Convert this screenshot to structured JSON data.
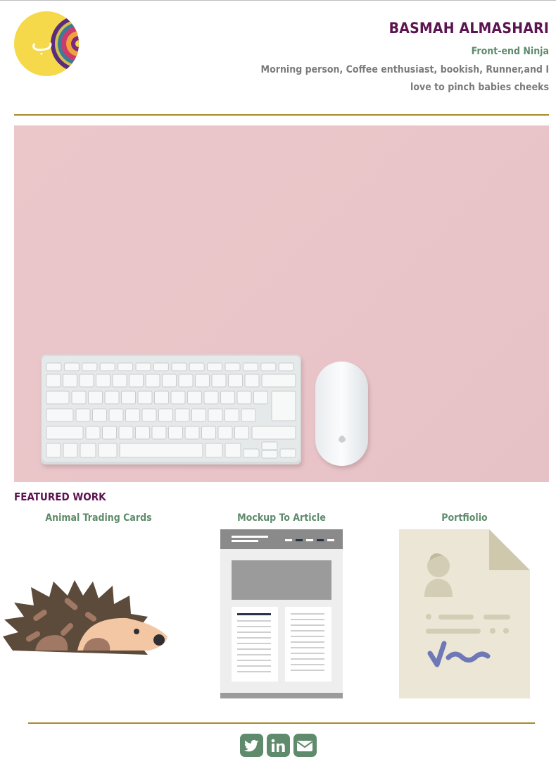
{
  "header": {
    "name": "BASMAH ALMASHARI",
    "role": "Front-end Ninja",
    "bio": "Morning person, Coffee enthusiast, bookish, Runner,and I love to pinch babies cheeks",
    "logo_letter": "ب"
  },
  "hero": {
    "image": "keyboard-and-mouse-on-pink-desk",
    "background_color": "#e9c5c9"
  },
  "featured": {
    "title": "FEATURED WORK",
    "items": [
      {
        "title": "Animal Trading Cards",
        "image": "hedgehog-illustration"
      },
      {
        "title": "Mockup To Article",
        "image": "article-mockup-illustration"
      },
      {
        "title": "Portfiolio",
        "image": "resume-document-illustration"
      }
    ]
  },
  "social": [
    {
      "name": "twitter",
      "icon": "twitter-icon"
    },
    {
      "name": "linkedin",
      "icon": "linkedin-icon"
    },
    {
      "name": "email",
      "icon": "envelope-icon"
    }
  ],
  "colors": {
    "name": "#5c1450",
    "accent_green": "#5f8b6c",
    "rule_gold": "#a78a2c",
    "bio_gray": "#7b7b7b"
  }
}
